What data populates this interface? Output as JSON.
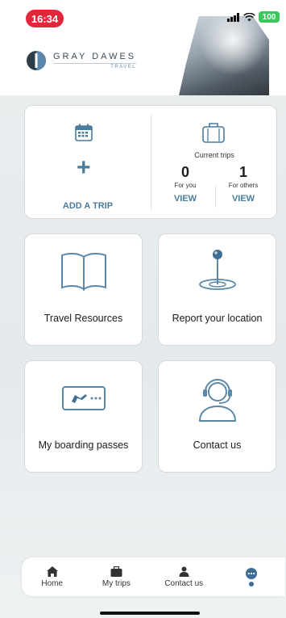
{
  "status_bar": {
    "time": "16:34",
    "battery": "100"
  },
  "logo": {
    "name": "GRAY DAWES",
    "sub": "TRAVEL"
  },
  "add_trip": {
    "label": "ADD A TRIP"
  },
  "current_trips": {
    "title": "Current trips",
    "for_you": {
      "count": "0",
      "label": "For you",
      "action": "VIEW"
    },
    "for_others": {
      "count": "1",
      "label": "For others",
      "action": "VIEW"
    }
  },
  "tiles": {
    "resources": "Travel Resources",
    "location": "Report your location",
    "boarding": "My boarding passes",
    "contact": "Contact us"
  },
  "bottom_nav": {
    "home": "Home",
    "trips": "My trips",
    "contact": "Contact us"
  },
  "colors": {
    "accent": "#4a7ca0",
    "time_pill": "#e3263a",
    "battery": "#38c85b"
  }
}
